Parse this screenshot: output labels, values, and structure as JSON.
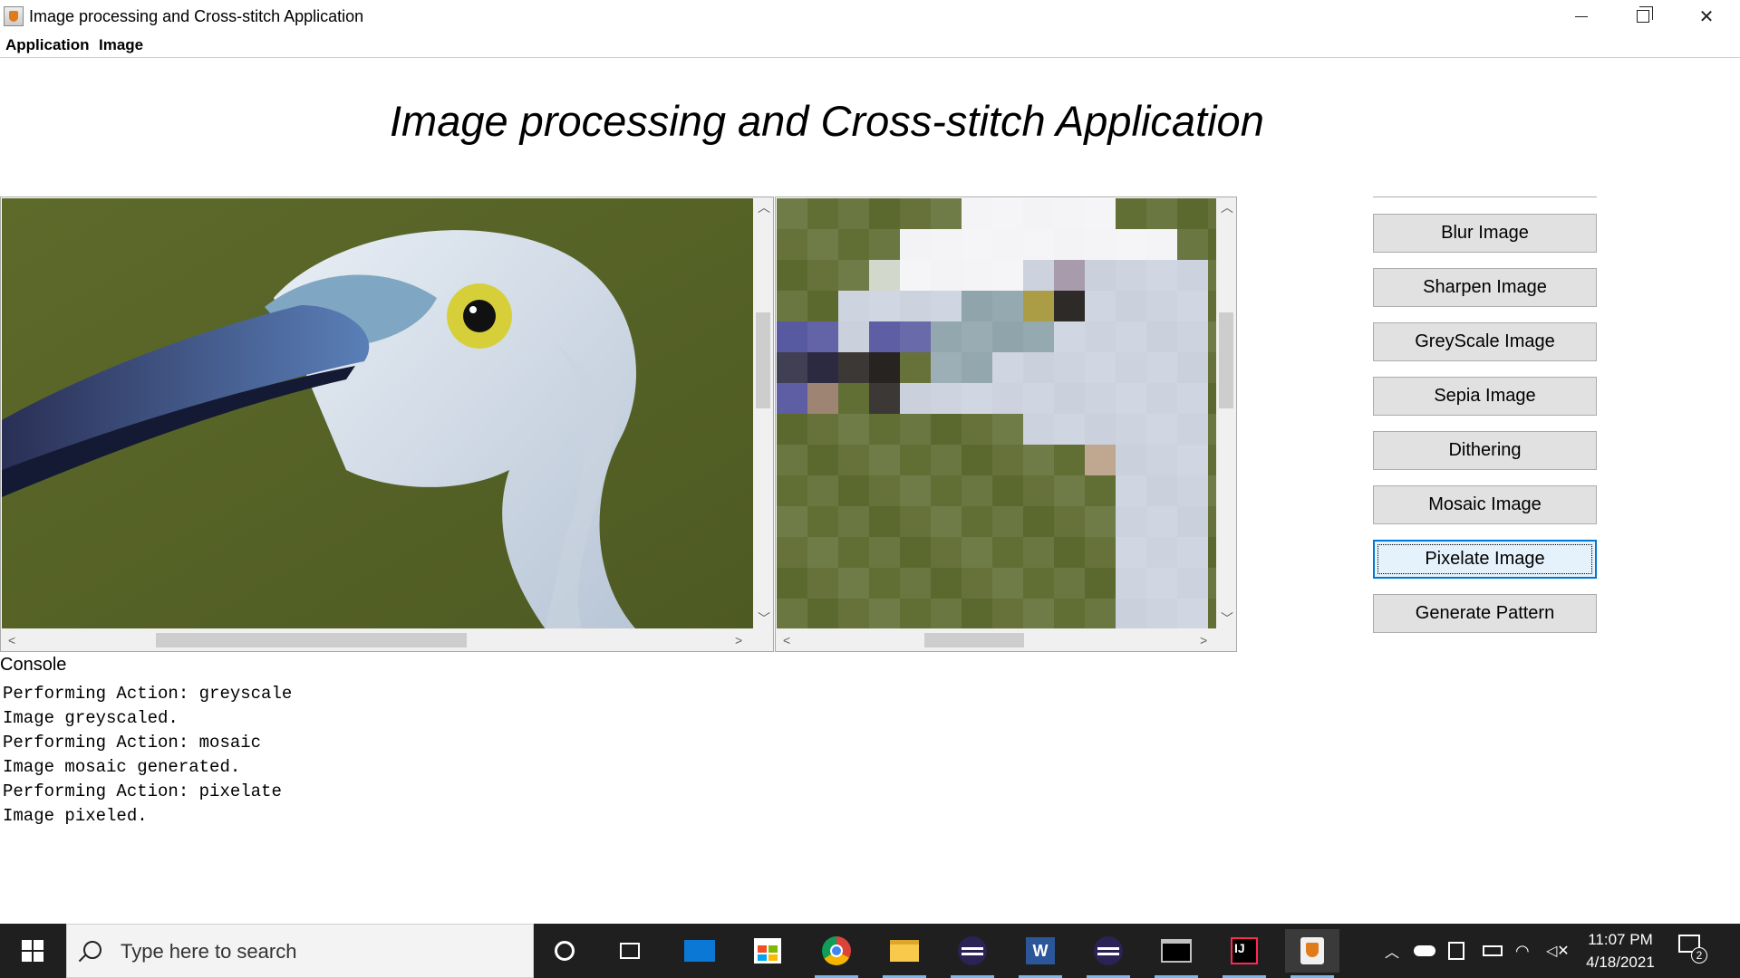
{
  "window": {
    "title": "Image processing and Cross-stitch Application",
    "controls": [
      "minimize",
      "restore",
      "close"
    ]
  },
  "menu": {
    "items": [
      {
        "label": "Application"
      },
      {
        "label": "Image"
      }
    ]
  },
  "header": {
    "title": "Image processing and Cross-stitch Application"
  },
  "panels": {
    "left": {
      "content": "original egret photo"
    },
    "right": {
      "content": "pixelated egret photo"
    }
  },
  "buttons": [
    {
      "label": "Blur Image"
    },
    {
      "label": "Sharpen Image"
    },
    {
      "label": "GreyScale Image"
    },
    {
      "label": "Sepia Image"
    },
    {
      "label": "Dithering"
    },
    {
      "label": "Mosaic Image"
    },
    {
      "label": "Pixelate Image",
      "focused": true
    },
    {
      "label": "Generate Pattern"
    }
  ],
  "console": {
    "label": "Console",
    "lines": [
      "Performing Action: greyscale",
      "Image greyscaled.",
      "Performing Action: mosaic",
      "Image mosaic generated.",
      "Performing Action: pixelate",
      "Image pixeled."
    ]
  },
  "taskbar": {
    "search_placeholder": "Type here to search",
    "pinned": [
      "cortana-icon",
      "task-view-icon",
      "mail-icon",
      "store-icon",
      "chrome-icon",
      "file-explorer-icon",
      "eclipse-icon",
      "word-icon",
      "eclipse-icon",
      "terminal-icon",
      "intellij-icon",
      "java-icon"
    ],
    "time": "11:07 PM",
    "date": "4/18/2021",
    "notification_count": "2"
  },
  "colors": {
    "accent": "#0078d7",
    "button_bg": "#e1e1e1",
    "taskbar_bg": "#1f1f1f"
  }
}
